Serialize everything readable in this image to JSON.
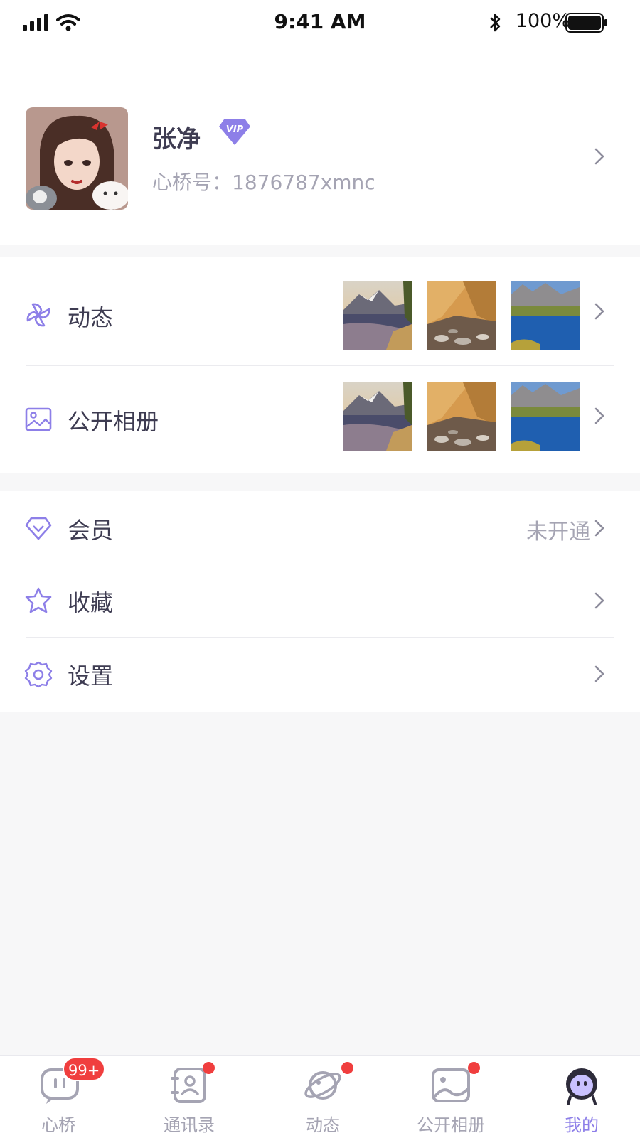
{
  "status_bar": {
    "time": "9:41 AM",
    "battery_text": "100%",
    "icons": [
      "signal-icon",
      "wifi-icon",
      "bluetooth-icon",
      "battery-icon"
    ]
  },
  "profile": {
    "name": "张净",
    "vip_badge": "VIP",
    "id_label": "心桥号：1876787xmnc"
  },
  "sections": {
    "dongtai": {
      "label": "动态",
      "icon": "pinwheel-icon"
    },
    "album": {
      "label": "公开相册",
      "icon": "image-icon"
    },
    "member": {
      "label": "会员",
      "value": "未开通",
      "icon": "diamond-icon"
    },
    "favorites": {
      "label": "收藏",
      "icon": "star-icon"
    },
    "settings": {
      "label": "设置",
      "icon": "gear-icon"
    }
  },
  "tabs": [
    {
      "label": "心桥",
      "icon": "chat-bubble-icon",
      "badge": "99+"
    },
    {
      "label": "通讯录",
      "icon": "contacts-icon"
    },
    {
      "label": "动态",
      "icon": "planet-icon"
    },
    {
      "label": "公开相册",
      "icon": "album-icon"
    },
    {
      "label": "我的",
      "icon": "profile-avatar-icon",
      "active": true
    }
  ],
  "colors": {
    "accent": "#8d7fe8",
    "text": "#3e3c52",
    "muted": "#a5a4b3",
    "badge": "#f03e3e"
  }
}
